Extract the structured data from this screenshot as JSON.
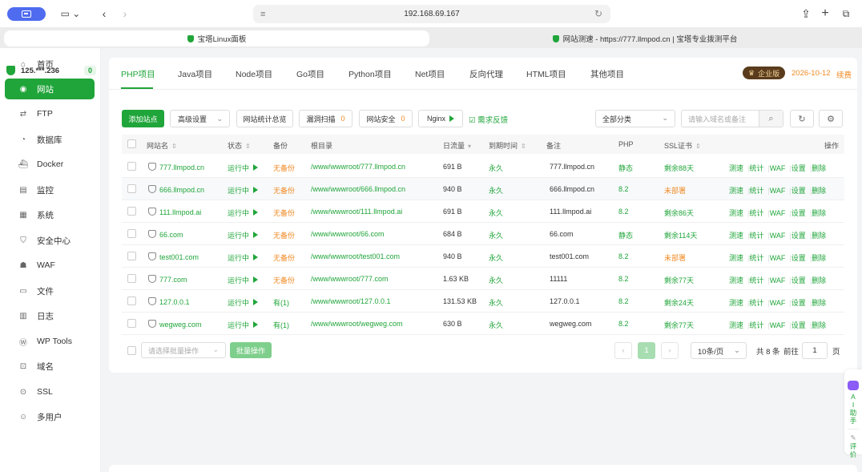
{
  "browser": {
    "url": "192.168.69.167",
    "tabs": [
      {
        "title": "宝塔Linux面板"
      },
      {
        "title": "网站测速 - https://777.llmpod.cn | 宝塔专业拨测平台"
      }
    ]
  },
  "sidebar": {
    "server": "125.***.236",
    "server_badge": "0",
    "items": [
      {
        "label": "首页",
        "icon": "home-icon"
      },
      {
        "label": "网站",
        "icon": "globe-icon"
      },
      {
        "label": "FTP",
        "icon": "transfer-icon"
      },
      {
        "label": "数据库",
        "icon": "database-icon"
      },
      {
        "label": "Docker",
        "icon": "docker-icon"
      },
      {
        "label": "监控",
        "icon": "monitor-icon"
      },
      {
        "label": "系统",
        "icon": "system-icon"
      },
      {
        "label": "安全中心",
        "icon": "shield-icon"
      },
      {
        "label": "WAF",
        "icon": "waf-icon"
      },
      {
        "label": "文件",
        "icon": "folder-icon"
      },
      {
        "label": "日志",
        "icon": "log-icon"
      },
      {
        "label": "WP Tools",
        "icon": "wordpress-icon"
      },
      {
        "label": "域名",
        "icon": "domain-icon"
      },
      {
        "label": "SSL",
        "icon": "ssl-icon"
      },
      {
        "label": "多用户",
        "icon": "users-icon"
      }
    ]
  },
  "project_tabs": [
    "PHP项目",
    "Java项目",
    "Node项目",
    "Go项目",
    "Python项目",
    "Net项目",
    "反向代理",
    "HTML项目",
    "其他项目"
  ],
  "license": {
    "badge": "企业版",
    "expire": "2026-10-12",
    "renew": "续费"
  },
  "toolbar": {
    "add_site": "添加站点",
    "advanced": "高级设置",
    "stats": "网站统计总览",
    "scan": "漏洞扫描",
    "scan_count": "0",
    "security": "网站安全",
    "security_count": "0",
    "nginx": "Nginx",
    "feedback": "需求反馈",
    "category": "全部分类",
    "search_placeholder": "请输入域名或备注"
  },
  "table": {
    "headers": {
      "name": "网站名",
      "status": "状态",
      "backup": "备份",
      "root": "根目录",
      "traffic": "日流量",
      "expire": "到期时间",
      "note": "备注",
      "php": "PHP",
      "ssl": "SSL证书",
      "ops": "操作"
    },
    "ops": [
      "测速",
      "统计",
      "WAF",
      "设置",
      "删除"
    ],
    "rows": [
      {
        "name": "777.llmpod.cn",
        "status": "运行中",
        "backup": "无备份",
        "root": "/www/wwwroot/777.llmpod.cn",
        "traffic": "691 B",
        "expire": "永久",
        "note": "777.llmpod.cn",
        "php": "静态",
        "ssl": "剩余88天"
      },
      {
        "name": "666.llmpod.cn",
        "status": "运行中",
        "backup": "无备份",
        "root": "/www/wwwroot/666.llmpod.cn",
        "traffic": "940 B",
        "expire": "永久",
        "note": "666.llmpod.cn",
        "php": "8.2",
        "ssl": "未部署"
      },
      {
        "name": "111.llmpod.ai",
        "status": "运行中",
        "backup": "无备份",
        "root": "/www/wwwroot/111.llmpod.ai",
        "traffic": "691 B",
        "expire": "永久",
        "note": "111.llmpod.ai",
        "php": "8.2",
        "ssl": "剩余86天"
      },
      {
        "name": "66.com",
        "status": "运行中",
        "backup": "无备份",
        "root": "/www/wwwroot/66.com",
        "traffic": "684 B",
        "expire": "永久",
        "note": "66.com",
        "php": "静态",
        "ssl": "剩余114天"
      },
      {
        "name": "test001.com",
        "status": "运行中",
        "backup": "无备份",
        "root": "/www/wwwroot/test001.com",
        "traffic": "940 B",
        "expire": "永久",
        "note": "test001.com",
        "php": "8.2",
        "ssl": "未部署"
      },
      {
        "name": "777.com",
        "status": "运行中",
        "backup": "无备份",
        "root": "/www/wwwroot/777.com",
        "traffic": "1.63 KB",
        "expire": "永久",
        "note": "11111",
        "php": "8.2",
        "ssl": "剩余77天"
      },
      {
        "name": "127.0.0.1",
        "status": "运行中",
        "backup": "有(1)",
        "root": "/www/wwwroot/127.0.0.1",
        "traffic": "131.53 KB",
        "expire": "永久",
        "note": "127.0.0.1",
        "php": "8.2",
        "ssl": "剩余24天"
      },
      {
        "name": "wegweg.com",
        "status": "运行中",
        "backup": "有(1)",
        "root": "/www/wwwroot/wegweg.com",
        "traffic": "630 B",
        "expire": "永久",
        "note": "wegweg.com",
        "php": "8.2",
        "ssl": "剩余77天"
      }
    ]
  },
  "footer": {
    "batch_placeholder": "请选择批量操作",
    "batch_button": "批量操作",
    "current_page": "1",
    "page_size": "10条/页",
    "total": "共 8 条",
    "goto_label": "前往",
    "goto_value": "1",
    "page_unit": "页"
  },
  "float": {
    "ai": "AI助手",
    "review": "评价"
  },
  "colors": {
    "brand": "#20a53a",
    "warn": "#f08a24",
    "chrome_accent": "#4f6cf0"
  }
}
